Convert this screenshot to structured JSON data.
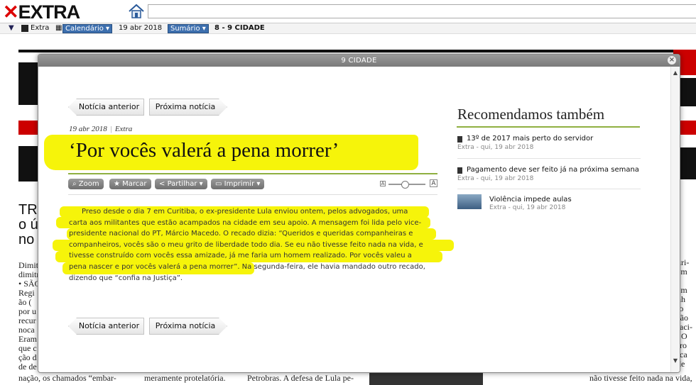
{
  "app": {
    "logo": "EXTRA"
  },
  "toolbar": {
    "publication": "Extra",
    "calendar_label": "Calendário ▾",
    "date": "19 abr 2018",
    "summary_label": "Sumário ▾",
    "page_label": "8 - 9 CIDADE"
  },
  "modal": {
    "title": "9 CIDADE",
    "nav": {
      "prev_label": "Notícia anterior",
      "next_label": "Próxima notícia"
    },
    "article": {
      "date": "19 abr 2018",
      "source": "Extra",
      "headline": "‘Por vocês valerá a pena morrer’",
      "tools": {
        "zoom": "Zoom",
        "mark": "Marcar",
        "share": "Partilhar ▾",
        "print": "Imprimir ▾"
      },
      "text_size_small": "A",
      "text_size_large": "A",
      "body_lines": [
        "Preso desde o dia 7 em Curitiba, o ex-presidente Lula enviou ontem, pelos advogados, uma",
        "carta aos militantes que estão acampados na cidade em seu apoio. A mensagem foi lida pelo vice-",
        "presidente nacional do PT, Márcio Macedo. O recado dizia: “Queridos e queridas companheiras e",
        "companheiros, vocês são o meu grito de liberdade todo dia. Se eu não tivesse feito nada na vida, e",
        "tivesse construído com vocês essa amizade, já me faria um homem realizado. Por vocês valeu a",
        "pena nascer e por vocês valerá a pena morrer”. Na segunda-feira, ele havia mandado outro recado,",
        "dizendo que “confia na Justiça”."
      ]
    },
    "recommended": {
      "title": "Recomendamos também",
      "items": [
        {
          "title": "13º de 2017 mais perto do servidor",
          "meta": "Extra - qui, 19 abr 2018"
        },
        {
          "title": "Pagamento deve ser feito já na próxima semana",
          "meta": "Extra - qui, 19 abr 2018"
        },
        {
          "title": "Violência impede aulas",
          "meta": "Extra - qui, 19 abr 2018"
        }
      ]
    }
  },
  "background": {
    "headline_lines": [
      "TR",
      "o ú",
      "no"
    ],
    "left_column": "Dimit\ndimitri\n• SÃO\nRegi\não (\npor u\nrecur\nnoca\nEram\nque c\nção d\nde de",
    "right_column": "uri-\nem\n-\nem\nnh\nto\nsão\nraci-\n. O\nrro\nrca\nde",
    "bottom_1": "nação, os chamados “embar-",
    "bottom_2": "meramente protelatória.",
    "bottom_3": "Petrobras. A defesa de Lula pe-",
    "bottom_4": "não tivesse feito nada na vida,"
  },
  "colors": {
    "highlight": "#f6f40a",
    "accent_green": "#8fb040",
    "brand_red": "#cc0000"
  }
}
